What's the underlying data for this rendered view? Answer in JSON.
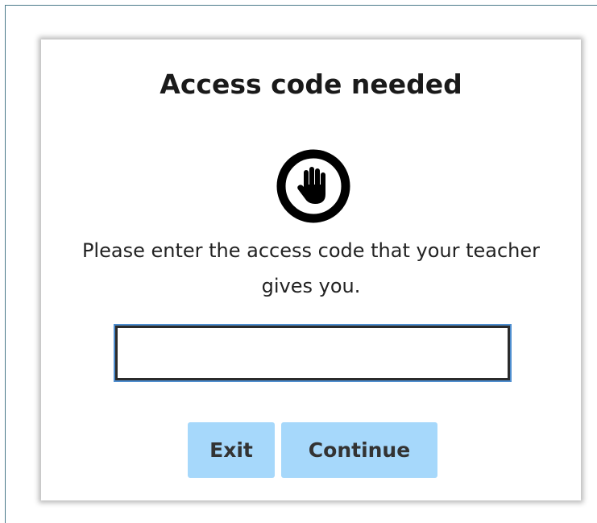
{
  "dialog": {
    "title": "Access code needed",
    "icon": "stop-hand-icon",
    "message": "Please enter the access code that your teacher gives you.",
    "input": {
      "value": "",
      "placeholder": ""
    },
    "buttons": {
      "exit_label": "Exit",
      "continue_label": "Continue"
    }
  },
  "colors": {
    "button_background": "#a6d8fb",
    "input_focus_outline": "#4f8ecf",
    "text": "#1a1a1a"
  }
}
